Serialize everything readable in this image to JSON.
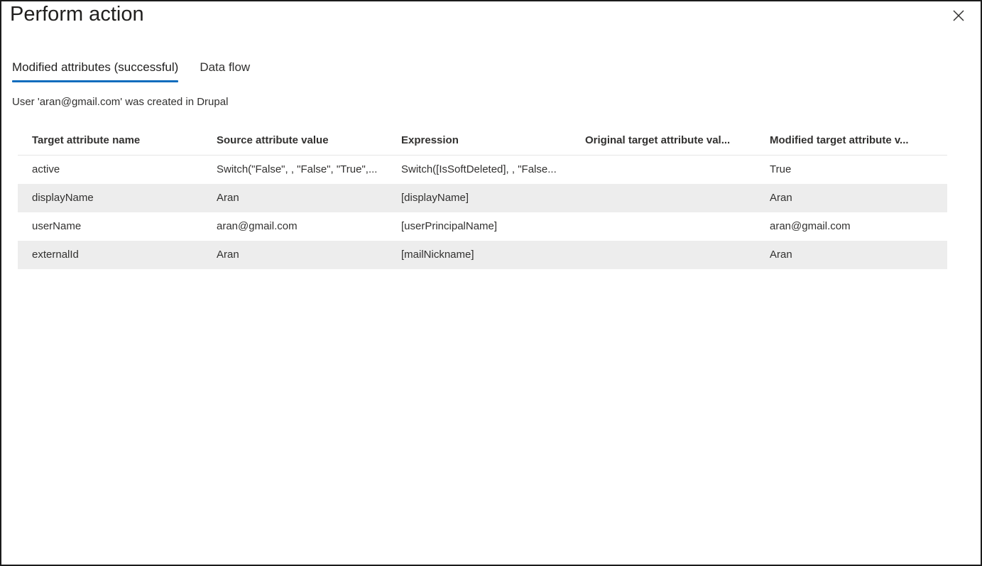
{
  "dialog": {
    "title": "Perform action",
    "close_icon": "close-icon"
  },
  "tabs": [
    {
      "label": "Modified attributes (successful)",
      "active": true
    },
    {
      "label": "Data flow",
      "active": false
    }
  ],
  "status_text": "User 'aran@gmail.com' was created in Drupal",
  "table": {
    "headers": [
      "Target attribute name",
      "Source attribute value",
      "Expression",
      "Original target attribute val...",
      "Modified target attribute v..."
    ],
    "rows": [
      [
        "active",
        "Switch(\"False\", , \"False\", \"True\",...",
        "Switch([IsSoftDeleted], , \"False...",
        "",
        "True"
      ],
      [
        "displayName",
        "Aran",
        "[displayName]",
        "",
        "Aran"
      ],
      [
        "userName",
        "aran@gmail.com",
        "[userPrincipalName]",
        "",
        "aran@gmail.com"
      ],
      [
        "externalId",
        "Aran",
        "[mailNickname]",
        "",
        "Aran"
      ]
    ]
  },
  "colors": {
    "accent": "#0f6cbd",
    "shaded_row": "#ededed",
    "border": "#1b1b1b"
  }
}
